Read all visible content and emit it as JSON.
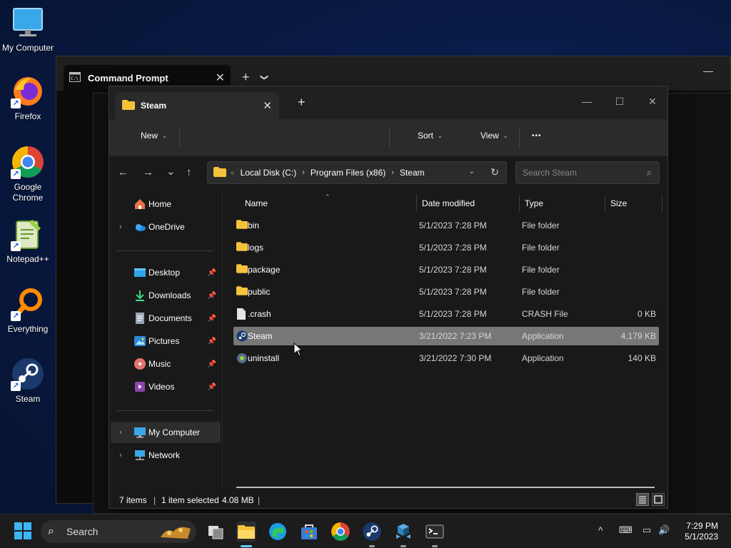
{
  "desktop": {
    "icons": [
      {
        "label": "My Computer",
        "icon": "monitor-icon"
      },
      {
        "label": "Firefox",
        "icon": "firefox-icon"
      },
      {
        "label": "Google Chrome",
        "icon": "chrome-icon"
      },
      {
        "label": "Notepad++",
        "icon": "notepad-plus-plus-icon"
      },
      {
        "label": "Everything",
        "icon": "everything-search-icon"
      },
      {
        "label": "Steam",
        "icon": "steam-icon"
      }
    ]
  },
  "cmd": {
    "tab_title": "Command Prompt",
    "close_glyph": "✕",
    "new_tab_glyph": "+",
    "dropdown_glyph": "❯",
    "minimize_glyph": "—"
  },
  "explorer": {
    "tab_title": "Steam",
    "close_glyph": "✕",
    "new_tab_glyph": "+",
    "window_controls": {
      "minimize": "—",
      "maximize": "☐",
      "close": "✕"
    },
    "toolbar": {
      "new_label": "New",
      "sort_label": "Sort",
      "view_label": "View",
      "more_label": "•••",
      "chevron": "⌄"
    },
    "nav_glyphs": {
      "back": "←",
      "forward": "→",
      "recent": "⌄",
      "up": "↑"
    },
    "address": {
      "overflow": "«",
      "crumbs": [
        "Local Disk (C:)",
        "Program Files (x86)",
        "Steam"
      ],
      "separator": "›",
      "dropdown_glyph": "⌄",
      "refresh_glyph": "↻"
    },
    "search": {
      "placeholder": "Search Steam",
      "icon_glyph": "⌕"
    },
    "nav_pane": {
      "expand_glyph": "›",
      "pin_glyph": "📌",
      "top": [
        {
          "label": "Home",
          "icon": "home-icon"
        },
        {
          "label": "OneDrive",
          "icon": "onedrive-cloud-icon"
        }
      ],
      "quick_access": [
        {
          "label": "Desktop",
          "icon": "desktop-folder-icon"
        },
        {
          "label": "Downloads",
          "icon": "downloads-icon"
        },
        {
          "label": "Documents",
          "icon": "documents-icon"
        },
        {
          "label": "Pictures",
          "icon": "pictures-icon"
        },
        {
          "label": "Music",
          "icon": "music-icon"
        },
        {
          "label": "Videos",
          "icon": "videos-icon"
        }
      ],
      "bottom": [
        {
          "label": "My Computer",
          "icon": "monitor-icon",
          "selected": true
        },
        {
          "label": "Network",
          "icon": "network-icon"
        }
      ]
    },
    "columns": {
      "name": "Name",
      "date": "Date modified",
      "type": "Type",
      "size": "Size",
      "sort_caret": "^"
    },
    "files": [
      {
        "name": "bin",
        "date": "5/1/2023 7:28 PM",
        "type": "File folder",
        "size": "",
        "icon": "folder-icon"
      },
      {
        "name": "logs",
        "date": "5/1/2023 7:28 PM",
        "type": "File folder",
        "size": "",
        "icon": "folder-icon"
      },
      {
        "name": "package",
        "date": "5/1/2023 7:28 PM",
        "type": "File folder",
        "size": "",
        "icon": "folder-icon"
      },
      {
        "name": "public",
        "date": "5/1/2023 7:28 PM",
        "type": "File folder",
        "size": "",
        "icon": "folder-icon"
      },
      {
        "name": ".crash",
        "date": "5/1/2023 7:28 PM",
        "type": "CRASH File",
        "size": "0 KB",
        "icon": "file-icon"
      },
      {
        "name": "Steam",
        "date": "3/21/2022 7:23 PM",
        "type": "Application",
        "size": "4,179 KB",
        "icon": "steam-icon",
        "selected": true
      },
      {
        "name": "uninstall",
        "date": "3/21/2022 7:30 PM",
        "type": "Application",
        "size": "140 KB",
        "icon": "uninstall-icon"
      }
    ],
    "status": {
      "item_count": "7 items",
      "selection": "1 item selected",
      "selection_size": "4.08 MB",
      "separator": "|"
    }
  },
  "taskbar": {
    "search_label": "Search",
    "search_glyph": "⌕",
    "apps": [
      {
        "icon": "start-windows-icon"
      },
      {
        "icon": "task-view-icon"
      },
      {
        "icon": "file-explorer-icon",
        "active": true
      },
      {
        "icon": "edge-icon"
      },
      {
        "icon": "microsoft-store-icon"
      },
      {
        "icon": "chrome-icon"
      },
      {
        "icon": "steam-icon"
      },
      {
        "icon": "app-cubes-icon"
      },
      {
        "icon": "terminal-icon"
      }
    ],
    "tray": {
      "chevron": "^",
      "keyboard": "⌨",
      "network": "▭",
      "volume": "🔊"
    },
    "time": "7:29 PM",
    "date": "5/1/2023"
  },
  "colors": {
    "accent": "#60cdff",
    "folder": "#f5c33b",
    "selection": "#777777",
    "window_bg": "#191919"
  }
}
